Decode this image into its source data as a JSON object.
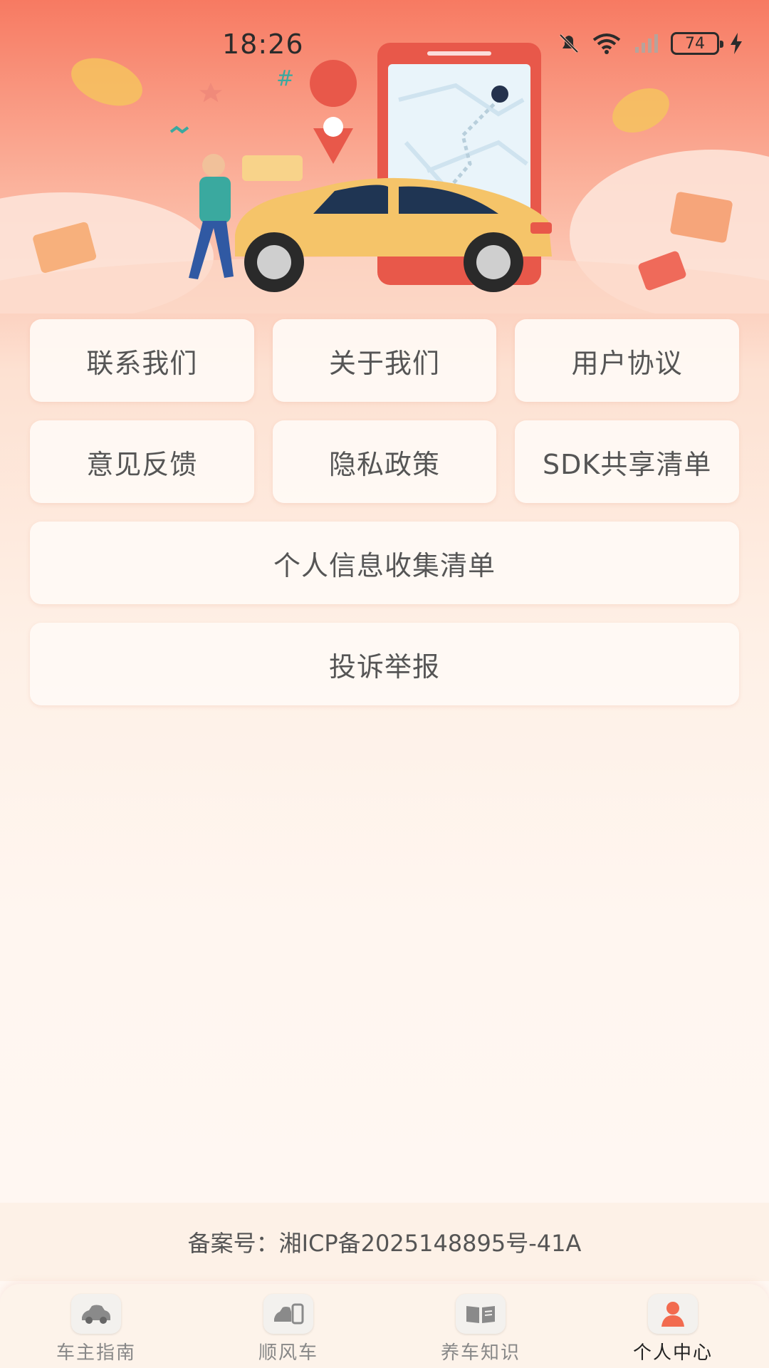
{
  "status_bar": {
    "time": "18:26",
    "battery": "74",
    "icons": [
      "mute-bell-icon",
      "wifi-icon",
      "cellular-signal-icon",
      "battery-icon",
      "charging-bolt-icon"
    ]
  },
  "hero": {
    "illustration": "person-with-car-and-phone-map"
  },
  "menu": {
    "row1": [
      "联系我们",
      "关于我们",
      "用户协议"
    ],
    "row2": [
      "意见反馈",
      "隐私政策",
      "SDK共享清单"
    ],
    "personal_info": "个人信息收集清单",
    "complaint": "投诉举报"
  },
  "footer": {
    "icp": "备案号：湘ICP备2025148895号-41A"
  },
  "tabs": [
    {
      "label": "车主指南",
      "icon": "car-icon",
      "active": false
    },
    {
      "label": "顺风车",
      "icon": "carpool-icon",
      "active": false
    },
    {
      "label": "养车知识",
      "icon": "book-icon",
      "active": false
    },
    {
      "label": "个人中心",
      "icon": "user-icon",
      "active": true
    }
  ],
  "colors": {
    "header_start": "#f77a62",
    "accent": "#f26b4f",
    "background_end": "#fff8f3",
    "button_text": "#555555"
  }
}
